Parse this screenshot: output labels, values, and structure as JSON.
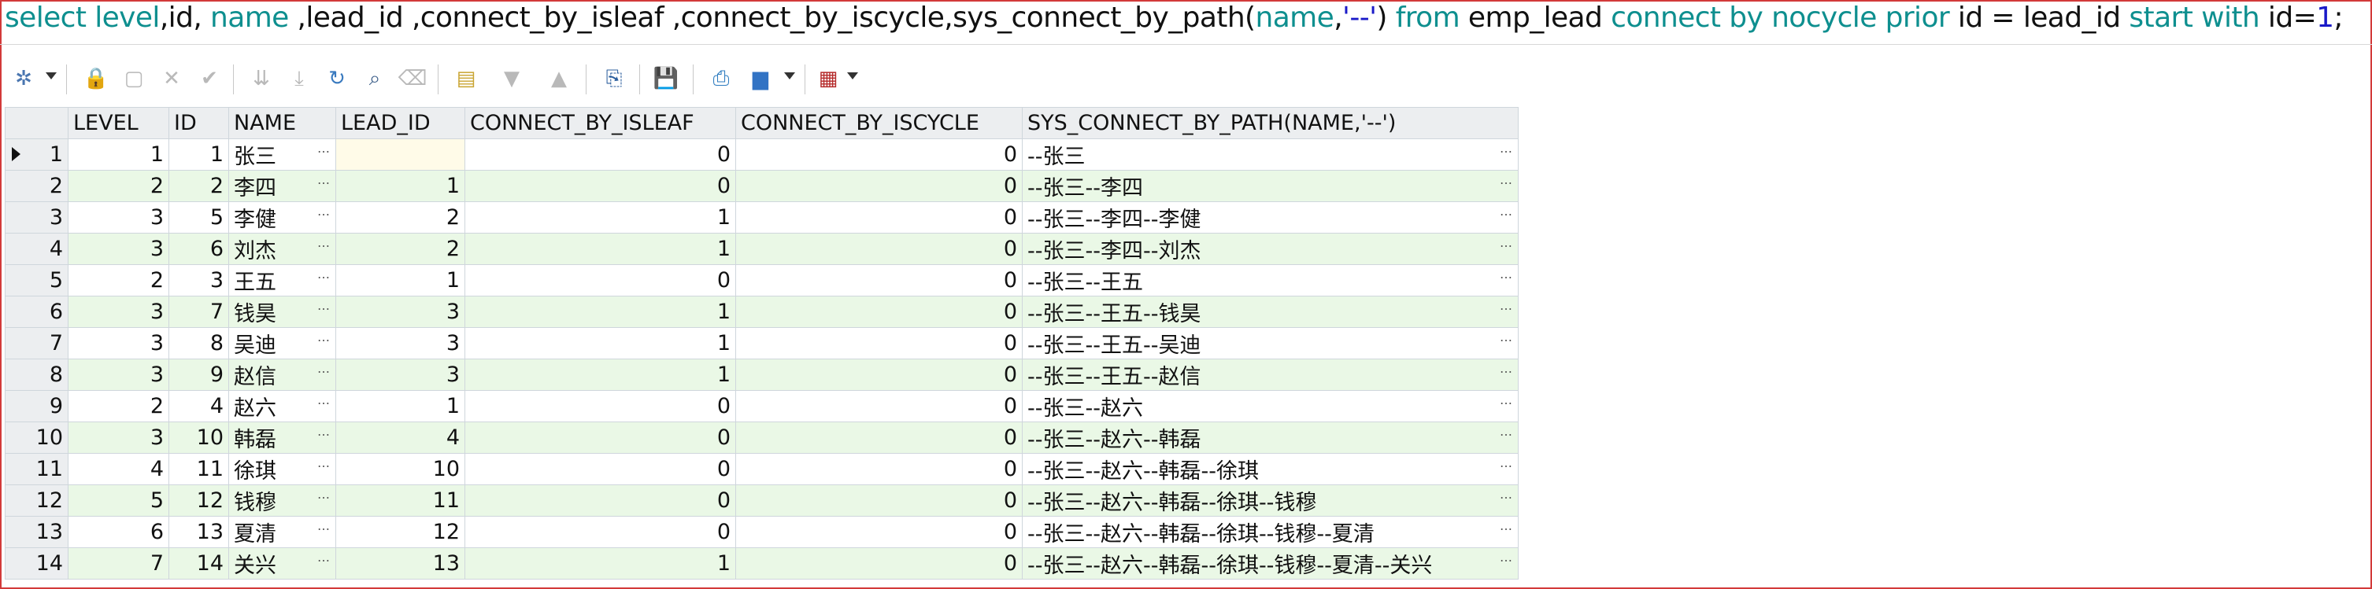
{
  "sql": {
    "parts": [
      {
        "t": "select ",
        "c": "kw"
      },
      {
        "t": "level",
        "c": "kw"
      },
      {
        "t": ",id, ",
        "c": "tx"
      },
      {
        "t": "name",
        "c": "kw"
      },
      {
        "t": " ,lead_id ,connect_by_isleaf ,connect_by_iscycle,sys_connect_by_path(",
        "c": "tx"
      },
      {
        "t": "name",
        "c": "kw"
      },
      {
        "t": ",",
        "c": "tx"
      },
      {
        "t": "'--'",
        "c": "st"
      },
      {
        "t": ") ",
        "c": "tx"
      },
      {
        "t": "from",
        "c": "kw"
      },
      {
        "t": " emp_lead ",
        "c": "tx"
      },
      {
        "t": "connect by nocycle prior",
        "c": "kw"
      },
      {
        "t": " id = lead_id ",
        "c": "tx"
      },
      {
        "t": "start with",
        "c": "kw"
      },
      {
        "t": " id=",
        "c": "tx"
      },
      {
        "t": "1",
        "c": "st"
      },
      {
        "t": ";",
        "c": "tx"
      }
    ]
  },
  "toolbar": {
    "icons": [
      "grid-options-icon",
      "lock-icon",
      "new-record-icon",
      "delete-record-icon",
      "post-changes-icon",
      "fetch-next-icon",
      "fetch-last-icon",
      "refresh-icon",
      "find-icon",
      "clear-icon",
      "query-by-example-icon",
      "filter-icon",
      "clear-filter-icon",
      "export-icon",
      "save-icon",
      "print-icon",
      "chart-icon",
      "table-view-icon"
    ]
  },
  "grid": {
    "columns": [
      "LEVEL",
      "ID",
      "NAME",
      "LEAD_ID",
      "CONNECT_BY_ISLEAF",
      "CONNECT_BY_ISCYCLE",
      "SYS_CONNECT_BY_PATH(NAME,'--')"
    ],
    "rows": [
      {
        "n": "1",
        "level": "1",
        "id": "1",
        "name": "张三",
        "lead": "",
        "leaf": "0",
        "cycle": "0",
        "path": "--张三"
      },
      {
        "n": "2",
        "level": "2",
        "id": "2",
        "name": "李四",
        "lead": "1",
        "leaf": "0",
        "cycle": "0",
        "path": "--张三--李四"
      },
      {
        "n": "3",
        "level": "3",
        "id": "5",
        "name": "李健",
        "lead": "2",
        "leaf": "1",
        "cycle": "0",
        "path": "--张三--李四--李健"
      },
      {
        "n": "4",
        "level": "3",
        "id": "6",
        "name": "刘杰",
        "lead": "2",
        "leaf": "1",
        "cycle": "0",
        "path": "--张三--李四--刘杰"
      },
      {
        "n": "5",
        "level": "2",
        "id": "3",
        "name": "王五",
        "lead": "1",
        "leaf": "0",
        "cycle": "0",
        "path": "--张三--王五"
      },
      {
        "n": "6",
        "level": "3",
        "id": "7",
        "name": "钱昊",
        "lead": "3",
        "leaf": "1",
        "cycle": "0",
        "path": "--张三--王五--钱昊"
      },
      {
        "n": "7",
        "level": "3",
        "id": "8",
        "name": "吴迪",
        "lead": "3",
        "leaf": "1",
        "cycle": "0",
        "path": "--张三--王五--吴迪"
      },
      {
        "n": "8",
        "level": "3",
        "id": "9",
        "name": "赵信",
        "lead": "3",
        "leaf": "1",
        "cycle": "0",
        "path": "--张三--王五--赵信"
      },
      {
        "n": "9",
        "level": "2",
        "id": "4",
        "name": "赵六",
        "lead": "1",
        "leaf": "0",
        "cycle": "0",
        "path": "--张三--赵六"
      },
      {
        "n": "10",
        "level": "3",
        "id": "10",
        "name": "韩磊",
        "lead": "4",
        "leaf": "0",
        "cycle": "0",
        "path": "--张三--赵六--韩磊"
      },
      {
        "n": "11",
        "level": "4",
        "id": "11",
        "name": "徐琪",
        "lead": "10",
        "leaf": "0",
        "cycle": "0",
        "path": "--张三--赵六--韩磊--徐琪"
      },
      {
        "n": "12",
        "level": "5",
        "id": "12",
        "name": "钱穆",
        "lead": "11",
        "leaf": "0",
        "cycle": "0",
        "path": "--张三--赵六--韩磊--徐琪--钱穆"
      },
      {
        "n": "13",
        "level": "6",
        "id": "13",
        "name": "夏清",
        "lead": "12",
        "leaf": "0",
        "cycle": "0",
        "path": "--张三--赵六--韩磊--徐琪--钱穆--夏清"
      },
      {
        "n": "14",
        "level": "7",
        "id": "14",
        "name": "关兴",
        "lead": "13",
        "leaf": "1",
        "cycle": "0",
        "path": "--张三--赵六--韩磊--徐琪--钱穆--夏清--关兴"
      }
    ]
  }
}
